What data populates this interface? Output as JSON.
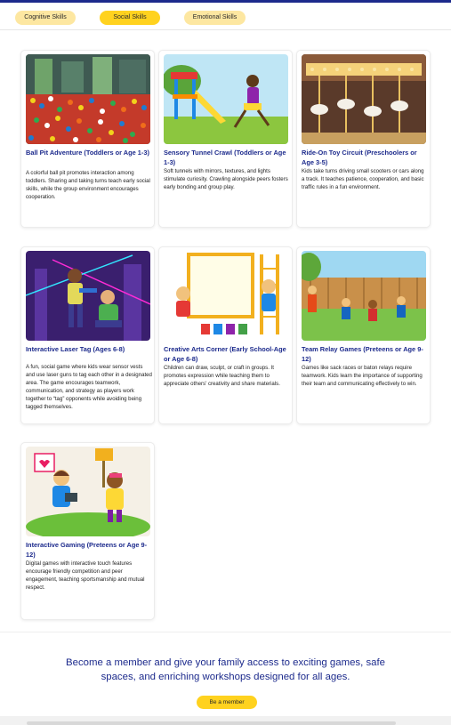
{
  "tabs": [
    {
      "label": "Cognitive Skills"
    },
    {
      "label": "Social Skills"
    },
    {
      "label": "Emotional Skills"
    }
  ],
  "cards": [
    {
      "title": "Ball Pit Adventure (Toddlers  or Age 1-3)",
      "description": "A colorful ball pit promotes interaction among toddlers. Sharing and taking turns teach early social skills, while the group environment encourages cooperation.",
      "image": "ball-pit-photo"
    },
    {
      "title": "Sensory Tunnel Crawl (Toddlers  or Age 1-3)",
      "description": "Soft tunnels with mirrors, textures, and lights stimulate curiosity. Crawling alongside peers fosters early bonding and group play.",
      "image": "playground-illustration"
    },
    {
      "title": "Ride-On Toy Circuit (Preschoolers or Age 3-5)",
      "description": "Kids take turns driving small scooters or cars along a track. It teaches patience, cooperation, and basic traffic rules in a fun environment.",
      "image": "carousel-photo"
    },
    {
      "title": "Interactive Laser Tag (Ages 6-8)",
      "description": "A fun, social game where kids wear sensor vests and use laser guns to tag each other in a designated area. The game encourages teamwork, communication, and strategy as players work together to “tag” opponents while avoiding being tagged themselves.",
      "image": "laser-tag-illustration"
    },
    {
      "title": "Creative Arts Corner (Early School-Age or Age 6-8)",
      "description": "Children can draw, sculpt, or craft in groups. It promotes expression while teaching them to appreciate others' creativity and share materials.",
      "image": "painting-illustration"
    },
    {
      "title": "Team Relay Games (Preteens or Age 9-12)",
      "description": "Games like sack races or baton relays require teamwork. Kids learn the importance of supporting their team and communicating effectively to win.",
      "image": "relay-race-illustration"
    },
    {
      "title": "Interactive Gaming (Preteens or Age 9-12)",
      "description": "Digital games with interactive touch features encourage friendly competition and peer engagement, teaching sportsmanship and mutual respect.",
      "image": "gaming-illustration"
    }
  ],
  "cta": {
    "text": "Become a member and give your family access to exciting games, safe spaces, and enriching workshops designed for all ages.",
    "button_label": "Be a member"
  },
  "colors": {
    "accent": "#1c2a8c",
    "tab_active": "#ffd21f",
    "tab_inactive": "#fde7a1"
  }
}
